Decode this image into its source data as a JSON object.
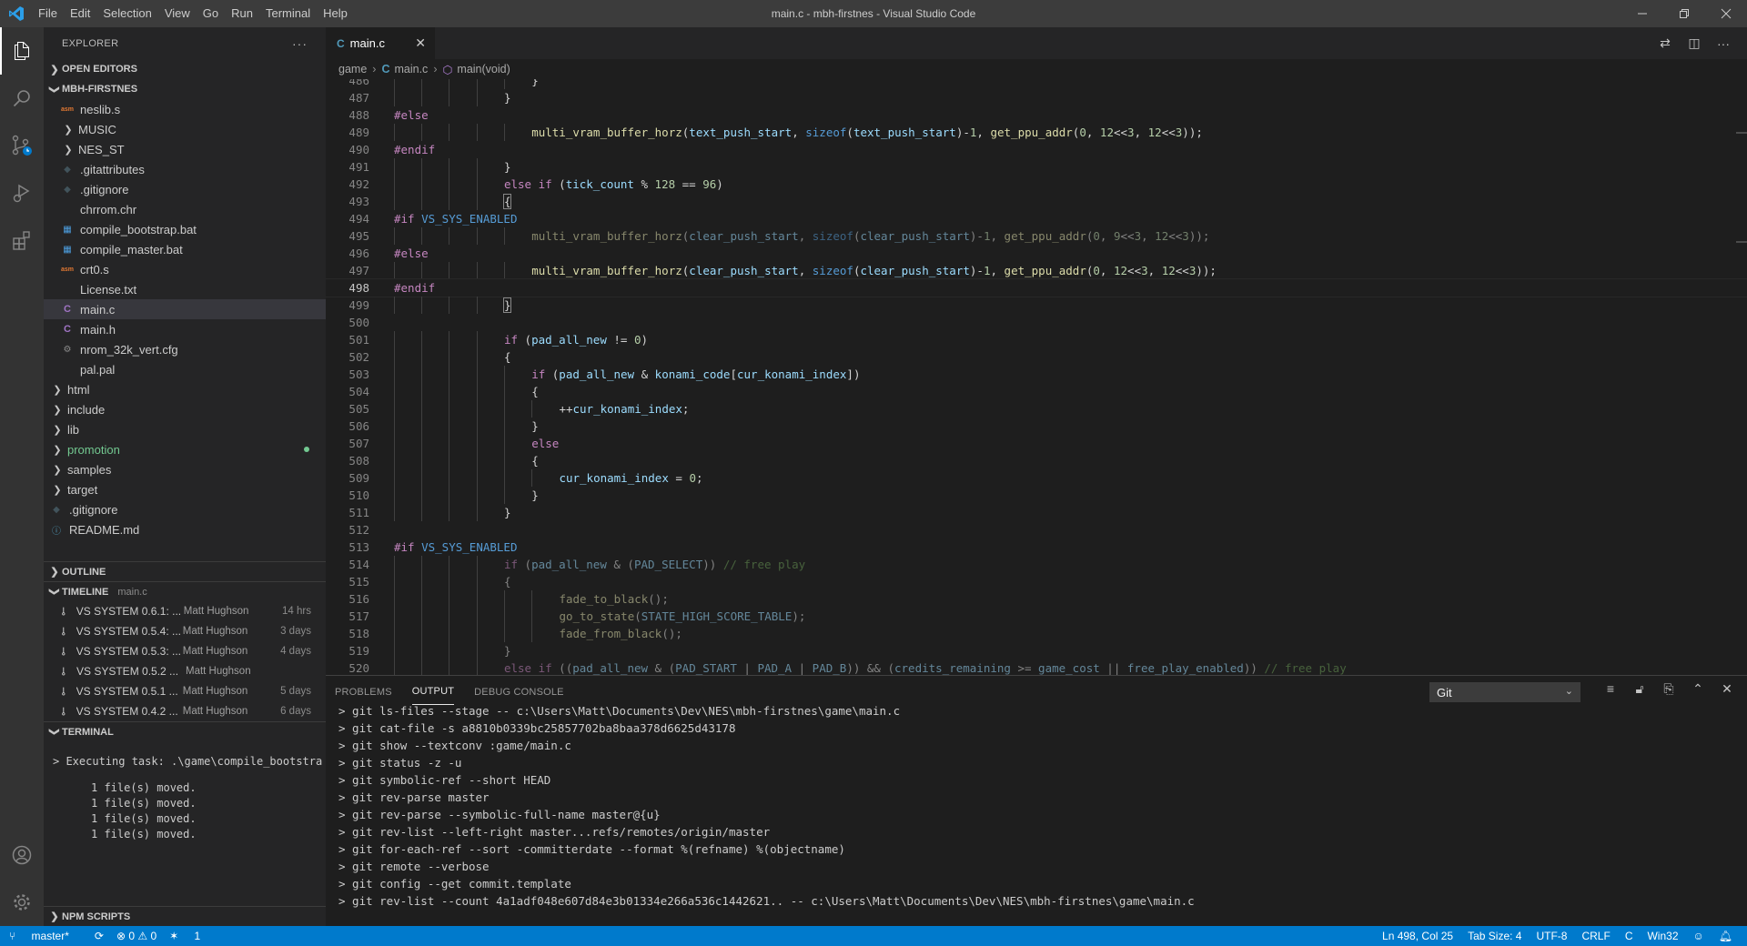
{
  "window": {
    "title": "main.c - mbh-firstnes - Visual Studio Code"
  },
  "menu": [
    "File",
    "Edit",
    "Selection",
    "View",
    "Go",
    "Run",
    "Terminal",
    "Help"
  ],
  "sidebar": {
    "title": "EXPLORER",
    "open_editors": "OPEN EDITORS",
    "project": "MBH-FIRSTNES",
    "files": [
      {
        "name": "neslib.s",
        "kind": "asm",
        "indent": 1
      },
      {
        "name": "MUSIC",
        "kind": "folder",
        "indent": 1
      },
      {
        "name": "NES_ST",
        "kind": "folder",
        "indent": 1
      },
      {
        "name": ".gitattributes",
        "kind": "git",
        "indent": 1
      },
      {
        "name": ".gitignore",
        "kind": "git",
        "indent": 1
      },
      {
        "name": "chrrom.chr",
        "kind": "file",
        "indent": 1
      },
      {
        "name": "compile_bootstrap.bat",
        "kind": "bat",
        "indent": 1
      },
      {
        "name": "compile_master.bat",
        "kind": "bat",
        "indent": 1
      },
      {
        "name": "crt0.s",
        "kind": "asm",
        "indent": 1
      },
      {
        "name": "License.txt",
        "kind": "file",
        "indent": 1
      },
      {
        "name": "main.c",
        "kind": "c",
        "indent": 1,
        "selected": true
      },
      {
        "name": "main.h",
        "kind": "c",
        "indent": 1
      },
      {
        "name": "nrom_32k_vert.cfg",
        "kind": "cfg",
        "indent": 1
      },
      {
        "name": "pal.pal",
        "kind": "file",
        "indent": 1
      },
      {
        "name": "html",
        "kind": "folder",
        "indent": 0
      },
      {
        "name": "include",
        "kind": "folder",
        "indent": 0
      },
      {
        "name": "lib",
        "kind": "folder",
        "indent": 0
      },
      {
        "name": "promotion",
        "kind": "folder-modified",
        "indent": 0
      },
      {
        "name": "samples",
        "kind": "folder",
        "indent": 0
      },
      {
        "name": "target",
        "kind": "folder",
        "indent": 0
      },
      {
        "name": ".gitignore",
        "kind": "git",
        "indent": 0
      },
      {
        "name": "README.md",
        "kind": "info",
        "indent": 0
      }
    ],
    "outline": "OUTLINE",
    "timeline": "TIMELINE",
    "timeline_file": "main.c",
    "timeline_items": [
      {
        "title": "VS SYSTEM 0.6.1: ...",
        "author": "Matt Hughson",
        "when": "14 hrs"
      },
      {
        "title": "VS SYSTEM 0.5.4: ...",
        "author": "Matt Hughson",
        "when": "3 days"
      },
      {
        "title": "VS SYSTEM 0.5.3: ...",
        "author": "Matt Hughson",
        "when": "4 days"
      },
      {
        "title": "VS SYSTEM 0.5.2 ...",
        "author": "Matt Hughson",
        "when": ""
      },
      {
        "title": "VS SYSTEM 0.5.1 ...",
        "author": "Matt Hughson",
        "when": "5 days"
      },
      {
        "title": "VS SYSTEM 0.4.2 ...",
        "author": "Matt Hughson",
        "when": "6 days"
      }
    ],
    "terminal": "TERMINAL",
    "terminal_task": "Executing task: .\\game\\compile_bootstra",
    "terminal_lines": [
      "1 file(s) moved.",
      "1 file(s) moved.",
      "1 file(s) moved.",
      "1 file(s) moved."
    ],
    "npm_scripts": "NPM SCRIPTS"
  },
  "tab": {
    "label": "main.c",
    "icon": "C"
  },
  "breadcrumbs": {
    "folder": "game",
    "file": "main.c",
    "symbol": "main(void)"
  },
  "code": {
    "current_line": 498,
    "lines": [
      {
        "n": 486,
        "ind": 5,
        "t": [
          [
            "}",
            ""
          ]
        ]
      },
      {
        "n": 487,
        "ind": 4,
        "t": [
          [
            "}",
            ""
          ]
        ]
      },
      {
        "n": 488,
        "ind": 0,
        "t": [
          [
            "#else",
            "pp"
          ]
        ]
      },
      {
        "n": 489,
        "ind": 5,
        "t": [
          [
            "multi_vram_buffer_horz",
            "fn"
          ],
          [
            "(",
            ""
          ],
          [
            "text_push_start",
            "v"
          ],
          [
            ", ",
            ""
          ],
          [
            "sizeof",
            "k2"
          ],
          [
            "(",
            ""
          ],
          [
            "text_push_start",
            "v"
          ],
          [
            ")-",
            ""
          ],
          [
            "1",
            "n"
          ],
          [
            ", ",
            ""
          ],
          [
            "get_ppu_addr",
            "fn"
          ],
          [
            "(",
            ""
          ],
          [
            "0",
            "n"
          ],
          [
            ", ",
            ""
          ],
          [
            "12",
            "n"
          ],
          [
            "<<",
            ""
          ],
          [
            "3",
            "n"
          ],
          [
            ", ",
            ""
          ],
          [
            "12",
            "n"
          ],
          [
            "<<",
            ""
          ],
          [
            "3",
            "n"
          ],
          [
            "));",
            ""
          ]
        ]
      },
      {
        "n": 490,
        "ind": 0,
        "t": [
          [
            "#endif",
            "pp"
          ]
        ]
      },
      {
        "n": 491,
        "ind": 4,
        "t": [
          [
            "}",
            ""
          ]
        ]
      },
      {
        "n": 492,
        "ind": 4,
        "t": [
          [
            "else if ",
            "kw"
          ],
          [
            "(",
            ""
          ],
          [
            "tick_count",
            "v"
          ],
          [
            " % ",
            ""
          ],
          [
            "128",
            "n"
          ],
          [
            " == ",
            ""
          ],
          [
            "96",
            "n"
          ],
          [
            ")",
            ""
          ]
        ]
      },
      {
        "n": 493,
        "ind": 4,
        "t": [
          [
            "{",
            "br"
          ]
        ]
      },
      {
        "n": 494,
        "ind": 0,
        "t": [
          [
            "#if ",
            "pp"
          ],
          [
            "VS_SYS_ENABLED",
            "k2"
          ]
        ]
      },
      {
        "n": 495,
        "ind": 5,
        "dim": true,
        "t": [
          [
            "multi_vram_buffer_horz",
            "fn"
          ],
          [
            "(",
            ""
          ],
          [
            "clear_push_start",
            "v"
          ],
          [
            ", ",
            ""
          ],
          [
            "sizeof",
            "k2"
          ],
          [
            "(",
            ""
          ],
          [
            "clear_push_start",
            "v"
          ],
          [
            ")-",
            ""
          ],
          [
            "1",
            "n"
          ],
          [
            ", ",
            ""
          ],
          [
            "get_ppu_addr",
            "fn"
          ],
          [
            "(",
            ""
          ],
          [
            "0",
            "n"
          ],
          [
            ", ",
            ""
          ],
          [
            "9",
            "n"
          ],
          [
            "<<",
            ""
          ],
          [
            "3",
            "n"
          ],
          [
            ", ",
            ""
          ],
          [
            "12",
            "n"
          ],
          [
            "<<",
            ""
          ],
          [
            "3",
            "n"
          ],
          [
            "));",
            ""
          ]
        ]
      },
      {
        "n": 496,
        "ind": 0,
        "t": [
          [
            "#else",
            "pp"
          ]
        ]
      },
      {
        "n": 497,
        "ind": 5,
        "t": [
          [
            "multi_vram_buffer_horz",
            "fn"
          ],
          [
            "(",
            ""
          ],
          [
            "clear_push_start",
            "v"
          ],
          [
            ", ",
            ""
          ],
          [
            "sizeof",
            "k2"
          ],
          [
            "(",
            ""
          ],
          [
            "clear_push_start",
            "v"
          ],
          [
            ")-",
            ""
          ],
          [
            "1",
            "n"
          ],
          [
            ", ",
            ""
          ],
          [
            "get_ppu_addr",
            "fn"
          ],
          [
            "(",
            ""
          ],
          [
            "0",
            "n"
          ],
          [
            ", ",
            ""
          ],
          [
            "12",
            "n"
          ],
          [
            "<<",
            ""
          ],
          [
            "3",
            "n"
          ],
          [
            ", ",
            ""
          ],
          [
            "12",
            "n"
          ],
          [
            "<<",
            ""
          ],
          [
            "3",
            "n"
          ],
          [
            "));",
            ""
          ]
        ]
      },
      {
        "n": 498,
        "ind": 0,
        "t": [
          [
            "#endif",
            "pp"
          ]
        ]
      },
      {
        "n": 499,
        "ind": 4,
        "t": [
          [
            "}",
            "br"
          ]
        ]
      },
      {
        "n": 500,
        "ind": 0,
        "t": []
      },
      {
        "n": 501,
        "ind": 4,
        "t": [
          [
            "if ",
            "kw"
          ],
          [
            "(",
            ""
          ],
          [
            "pad_all_new",
            "v"
          ],
          [
            " != ",
            ""
          ],
          [
            "0",
            "n"
          ],
          [
            ")",
            ""
          ]
        ]
      },
      {
        "n": 502,
        "ind": 4,
        "t": [
          [
            "{",
            ""
          ]
        ]
      },
      {
        "n": 503,
        "ind": 5,
        "t": [
          [
            "if ",
            "kw"
          ],
          [
            "(",
            ""
          ],
          [
            "pad_all_new",
            "v"
          ],
          [
            " & ",
            ""
          ],
          [
            "konami_code",
            "v"
          ],
          [
            "[",
            ""
          ],
          [
            "cur_konami_index",
            "v"
          ],
          [
            "])",
            ""
          ]
        ]
      },
      {
        "n": 504,
        "ind": 5,
        "t": [
          [
            "{",
            ""
          ]
        ]
      },
      {
        "n": 505,
        "ind": 6,
        "t": [
          [
            "++",
            ""
          ],
          [
            "cur_konami_index",
            "v"
          ],
          [
            ";",
            ""
          ]
        ]
      },
      {
        "n": 506,
        "ind": 5,
        "t": [
          [
            "}",
            ""
          ]
        ]
      },
      {
        "n": 507,
        "ind": 5,
        "t": [
          [
            "else",
            "kw"
          ]
        ]
      },
      {
        "n": 508,
        "ind": 5,
        "t": [
          [
            "{",
            ""
          ]
        ]
      },
      {
        "n": 509,
        "ind": 6,
        "t": [
          [
            "cur_konami_index",
            "v"
          ],
          [
            " = ",
            ""
          ],
          [
            "0",
            "n"
          ],
          [
            ";",
            ""
          ]
        ]
      },
      {
        "n": 510,
        "ind": 5,
        "t": [
          [
            "}",
            ""
          ]
        ]
      },
      {
        "n": 511,
        "ind": 4,
        "t": [
          [
            "}",
            ""
          ]
        ]
      },
      {
        "n": 512,
        "ind": 0,
        "t": []
      },
      {
        "n": 513,
        "ind": 0,
        "t": [
          [
            "#if ",
            "pp"
          ],
          [
            "VS_SYS_ENABLED",
            "k2"
          ]
        ]
      },
      {
        "n": 514,
        "ind": 4,
        "dim": true,
        "t": [
          [
            "if ",
            "kw"
          ],
          [
            "(",
            ""
          ],
          [
            "pad_all_new",
            "v"
          ],
          [
            " & (",
            ""
          ],
          [
            "PAD_SELECT",
            "v"
          ],
          [
            ")) ",
            ""
          ],
          [
            "// free play",
            "cm"
          ]
        ]
      },
      {
        "n": 515,
        "ind": 4,
        "dim": true,
        "t": [
          [
            "{",
            ""
          ]
        ]
      },
      {
        "n": 516,
        "ind": 6,
        "dim": true,
        "t": [
          [
            "fade_to_black",
            "fn"
          ],
          [
            "();",
            ""
          ]
        ]
      },
      {
        "n": 517,
        "ind": 6,
        "dim": true,
        "t": [
          [
            "go_to_state",
            "fn"
          ],
          [
            "(",
            ""
          ],
          [
            "STATE_HIGH_SCORE_TABLE",
            "v"
          ],
          [
            ");",
            ""
          ]
        ]
      },
      {
        "n": 518,
        "ind": 6,
        "dim": true,
        "t": [
          [
            "fade_from_black",
            "fn"
          ],
          [
            "();",
            ""
          ]
        ]
      },
      {
        "n": 519,
        "ind": 4,
        "dim": true,
        "t": [
          [
            "}",
            ""
          ]
        ]
      },
      {
        "n": 520,
        "ind": 4,
        "dim": true,
        "t": [
          [
            "else if ",
            "kw"
          ],
          [
            "((",
            ""
          ],
          [
            "pad_all_new",
            "v"
          ],
          [
            " & (",
            ""
          ],
          [
            "PAD_START",
            "v"
          ],
          [
            " | ",
            ""
          ],
          [
            "PAD_A",
            "v"
          ],
          [
            " | ",
            ""
          ],
          [
            "PAD_B",
            "v"
          ],
          [
            ")) && (",
            ""
          ],
          [
            "credits_remaining",
            "v"
          ],
          [
            " >= ",
            ""
          ],
          [
            "game_cost",
            "v"
          ],
          [
            " || ",
            ""
          ],
          [
            "free_play_enabled",
            "v"
          ],
          [
            ")) ",
            ""
          ],
          [
            "// free play",
            "cm"
          ]
        ]
      }
    ]
  },
  "panel": {
    "tabs": [
      "PROBLEMS",
      "OUTPUT",
      "DEBUG CONSOLE"
    ],
    "active_tab": "OUTPUT",
    "select_value": "Git",
    "output_lines": [
      "> git ls-files --stage -- c:\\Users\\Matt\\Documents\\Dev\\NES\\mbh-firstnes\\game\\main.c",
      "> git cat-file -s a8810b0339bc25857702ba8baa378d6625d43178",
      "> git show --textconv :game/main.c",
      "> git status -z -u",
      "> git symbolic-ref --short HEAD",
      "> git rev-parse master",
      "> git rev-parse --symbolic-full-name master@{u}",
      "> git rev-list --left-right master...refs/remotes/origin/master",
      "> git for-each-ref --sort -committerdate --format %(refname) %(objectname)",
      "> git remote --verbose",
      "> git config --get commit.template",
      "> git rev-list --count 4a1adf048e607d84e3b01334e266a536c1442621.. -- c:\\Users\\Matt\\Documents\\Dev\\NES\\mbh-firstnes\\game\\main.c"
    ]
  },
  "statusbar": {
    "branch": "master*",
    "sync": "⟳",
    "problems": "⊗ 0 ⚠ 0",
    "remote": "1",
    "position": "Ln 498, Col 25",
    "tab_size": "Tab Size: 4",
    "encoding": "UTF-8",
    "eol": "CRLF",
    "language": "C",
    "platform": "Win32"
  },
  "colors": {
    "accent": "#007acc",
    "titlebar": "#3c3c3c",
    "activitybar": "#333333",
    "sidebar": "#252526",
    "editor": "#1e1e1e"
  }
}
